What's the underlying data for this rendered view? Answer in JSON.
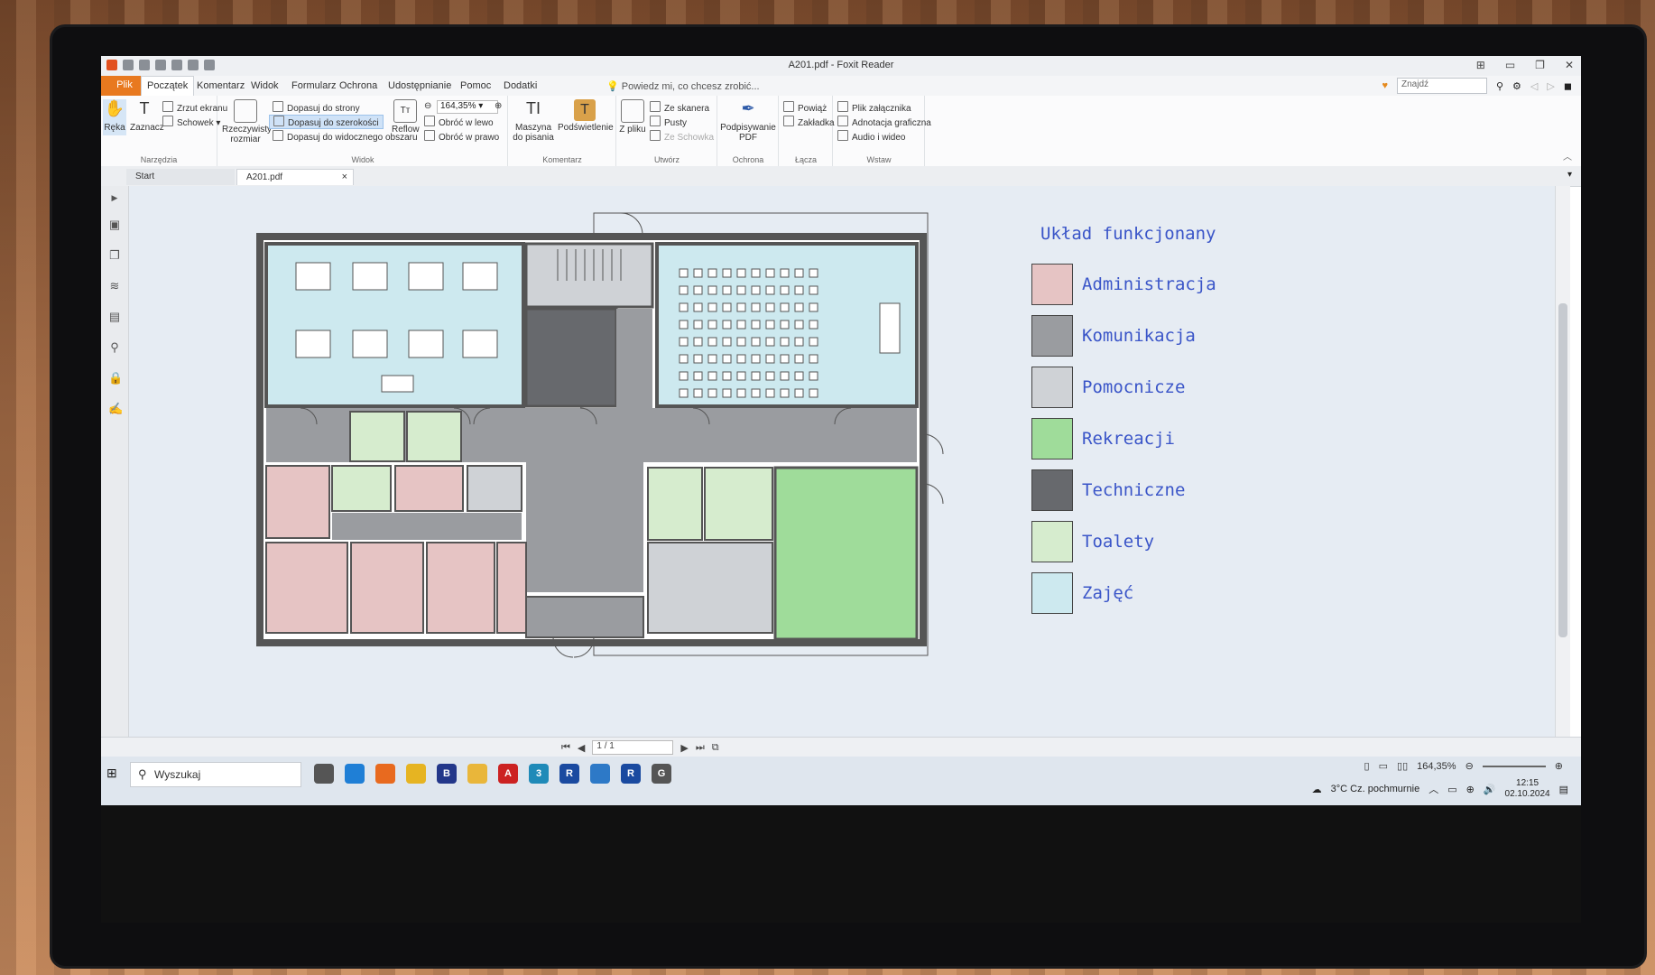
{
  "window": {
    "title": "A201.pdf - Foxit Reader"
  },
  "menu": {
    "file": "Plik",
    "tabs": [
      "Początek",
      "Komentarz",
      "Widok",
      "Formularz",
      "Ochrona",
      "Udostępnianie",
      "Pomoc",
      "Dodatki"
    ],
    "tell_me": "Powiedz mi, co chcesz zrobić...",
    "find_placeholder": "Znajdź"
  },
  "ribbon": {
    "narzedzia": {
      "label": "Narzędzia",
      "reka": "Ręka",
      "zaznacz": "Zaznacz",
      "zrzut": "Zrzut ekranu",
      "schowek": "Schowek"
    },
    "widok": {
      "label": "Widok",
      "rzeczywisty": "Rzeczywisty rozmiar",
      "dopasuj_strony": "Dopasuj do strony",
      "dopasuj_szer": "Dopasuj do szerokości",
      "dopasuj_obszaru": "Dopasuj do widocznego obszaru",
      "reflow": "Reflow",
      "zoom": "164,35%",
      "obroc_lewo": "Obróć w lewo",
      "obroc_prawo": "Obróć w prawo"
    },
    "komentarz": {
      "label": "Komentarz",
      "maszyna": "Maszyna do pisania",
      "podswietlenie": "Podświetlenie"
    },
    "utworz": {
      "label": "Utwórz",
      "z_pliku": "Z pliku",
      "ze_skanera": "Ze skanera",
      "pusty": "Pusty",
      "ze_schowka": "Ze Schowka"
    },
    "ochrona": {
      "label": "Ochrona",
      "podpisywanie": "Podpisywanie PDF"
    },
    "lacza": {
      "label": "Łącza",
      "powiaz": "Powiąż",
      "zakladka": "Zakładka"
    },
    "wstaw": {
      "label": "Wstaw",
      "plik_zal": "Plik załącznika",
      "adnotacja": "Adnotacja graficzna",
      "audio": "Audio i wideo"
    }
  },
  "doc_tabs": [
    "Start",
    "A201.pdf"
  ],
  "legend": {
    "title": "Układ funkcjonany",
    "items": [
      {
        "label": "Administracja",
        "color": "#e6c4c4"
      },
      {
        "label": "Komunikacja",
        "color": "#9a9ca0"
      },
      {
        "label": "Pomocnicze",
        "color": "#cfd2d6"
      },
      {
        "label": "Rekreacji",
        "color": "#9fdc9a"
      },
      {
        "label": "Techniczne",
        "color": "#67696d"
      },
      {
        "label": "Toalety",
        "color": "#d6ecce"
      },
      {
        "label": "Zajęć",
        "color": "#cde9ef"
      }
    ]
  },
  "pager": {
    "page": "1 / 1"
  },
  "taskbar": {
    "search": "Wyszukaj",
    "zoom": "164,35%",
    "weather": "3°C  Cz. pochmurnie",
    "time": "12:15",
    "date": "02.10.2024"
  }
}
